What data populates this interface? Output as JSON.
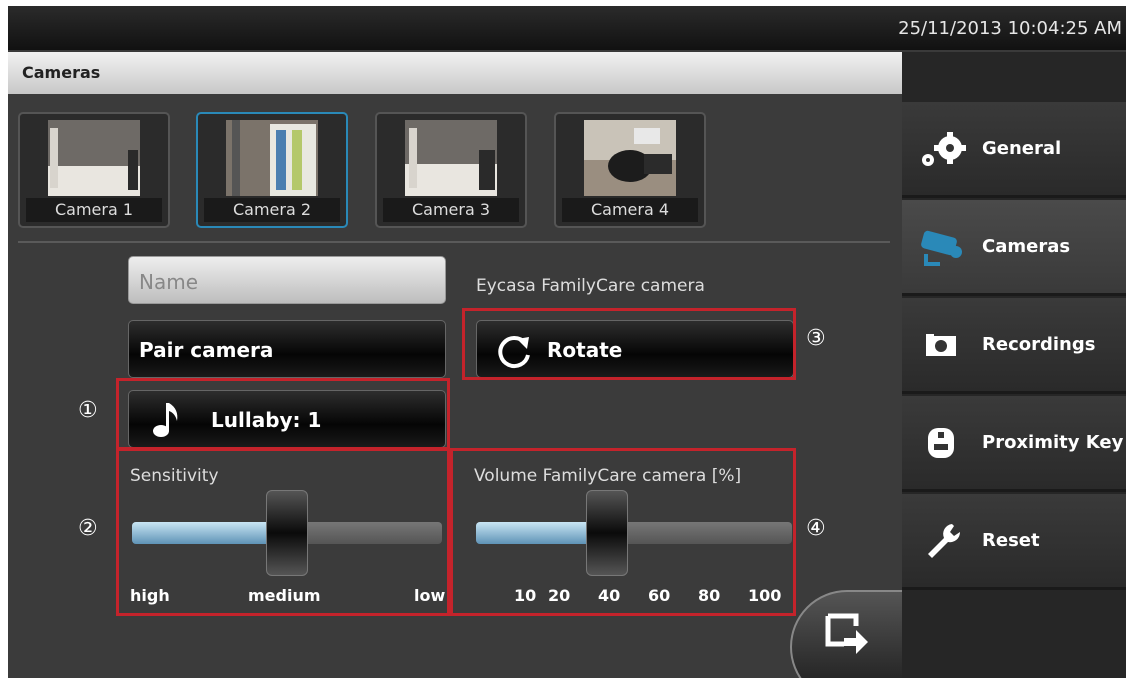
{
  "status_bar": {
    "datetime": "25/11/2013 10:04:25 AM"
  },
  "header": {
    "title": "Cameras"
  },
  "cameras": [
    {
      "label": "Camera 1",
      "selected": false
    },
    {
      "label": "Camera 2",
      "selected": true
    },
    {
      "label": "Camera 3",
      "selected": false
    },
    {
      "label": "Camera 4",
      "selected": false
    }
  ],
  "form": {
    "name_placeholder": "Name",
    "pair_label": "Pair camera",
    "camera_model": "Eycasa FamilyCare camera",
    "rotate_label": "Rotate",
    "lullaby_label": "Lullaby: 1"
  },
  "sensitivity": {
    "label": "Sensitivity",
    "ticks": [
      "high",
      "medium",
      "low"
    ],
    "value": "medium"
  },
  "volume": {
    "label": "Volume FamilyCare camera [%]",
    "ticks": [
      "10",
      "20",
      "40",
      "60",
      "80",
      "100"
    ],
    "value": 40
  },
  "annotations": [
    "①",
    "②",
    "③",
    "④"
  ],
  "sidebar": {
    "items": [
      {
        "label": "General",
        "icon": "gears-icon",
        "selected": false
      },
      {
        "label": "Cameras",
        "icon": "camera-icon",
        "selected": true
      },
      {
        "label": "Recordings",
        "icon": "recordings-icon",
        "selected": false
      },
      {
        "label": "Proximity Key",
        "icon": "key-icon",
        "selected": false
      },
      {
        "label": "Reset",
        "icon": "wrench-icon",
        "selected": false
      }
    ]
  },
  "colors": {
    "accent": "#2a89b8",
    "highlight_box": "#c4232b",
    "slider_fill": "#7fb3d4"
  }
}
